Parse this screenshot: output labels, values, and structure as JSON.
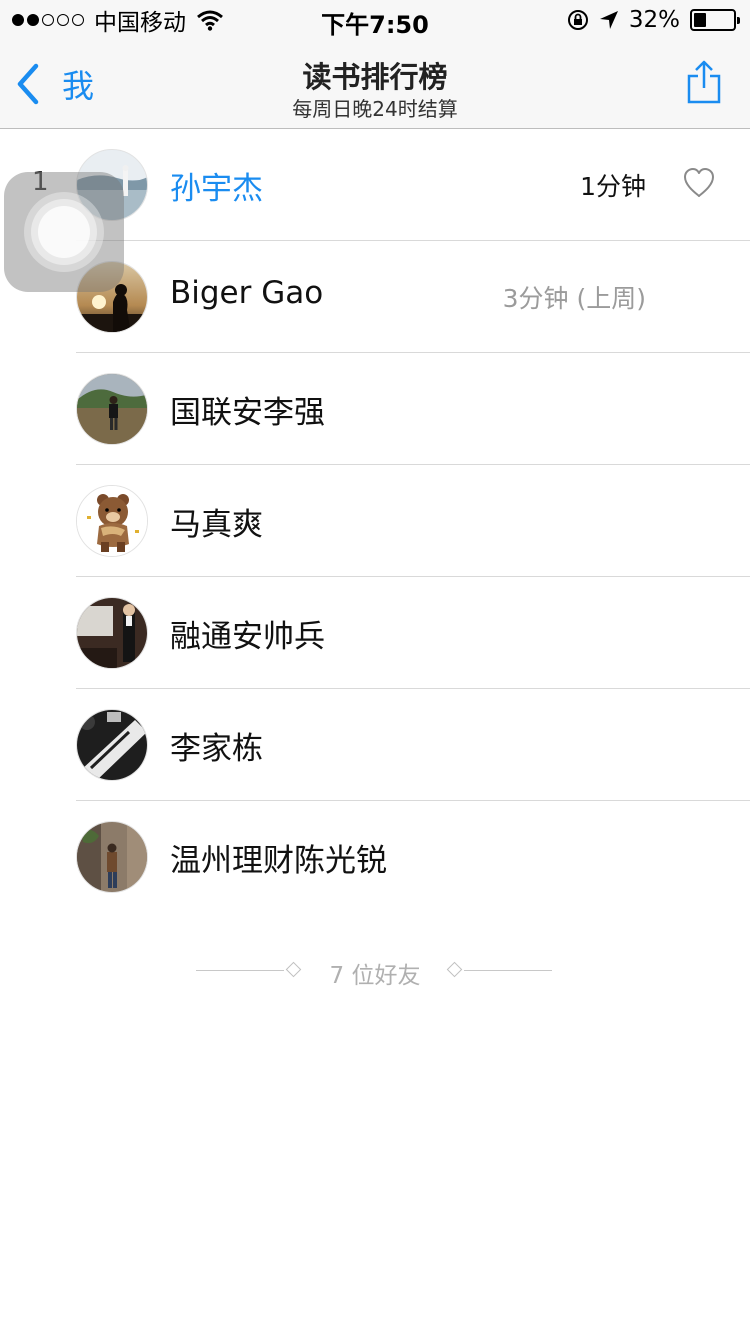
{
  "status_bar": {
    "carrier": "中国移动",
    "signal_bars_filled": 2,
    "signal_bars_total": 5,
    "time": "下午7:50",
    "battery_percent": "32%",
    "battery_level": 0.32,
    "icons": [
      "wifi-icon",
      "orientation-lock-icon",
      "location-arrow-icon",
      "battery-icon"
    ]
  },
  "nav": {
    "back_label": "我",
    "title": "读书排行榜",
    "subtitle": "每周日晚24时结算",
    "accent_color": "#1a8cf0"
  },
  "ranking": [
    {
      "rank": "1",
      "name": "孙宇杰",
      "time": "1分钟",
      "is_me": true,
      "liked": false,
      "avatar": "photo-lake-avatar"
    },
    {
      "rank": "",
      "name": "Biger Gao",
      "time": "3分钟 (上周)",
      "is_me": false,
      "avatar": "photo-sunset-avatar"
    },
    {
      "rank": "",
      "name": "国联安李强",
      "time": "",
      "is_me": false,
      "avatar": "photo-field-avatar"
    },
    {
      "rank": "",
      "name": "马真爽",
      "time": "",
      "is_me": false,
      "avatar": "cartoon-bear-avatar"
    },
    {
      "rank": "",
      "name": "融通安帅兵",
      "time": "",
      "is_me": false,
      "avatar": "photo-speaker-avatar"
    },
    {
      "rank": "",
      "name": "李家栋",
      "time": "",
      "is_me": false,
      "avatar": "photo-mono-avatar"
    },
    {
      "rank": "",
      "name": "温州理财陈光锐",
      "time": "",
      "is_me": false,
      "avatar": "photo-alley-avatar"
    }
  ],
  "footer": {
    "friends_count_label": "7 位好友"
  }
}
